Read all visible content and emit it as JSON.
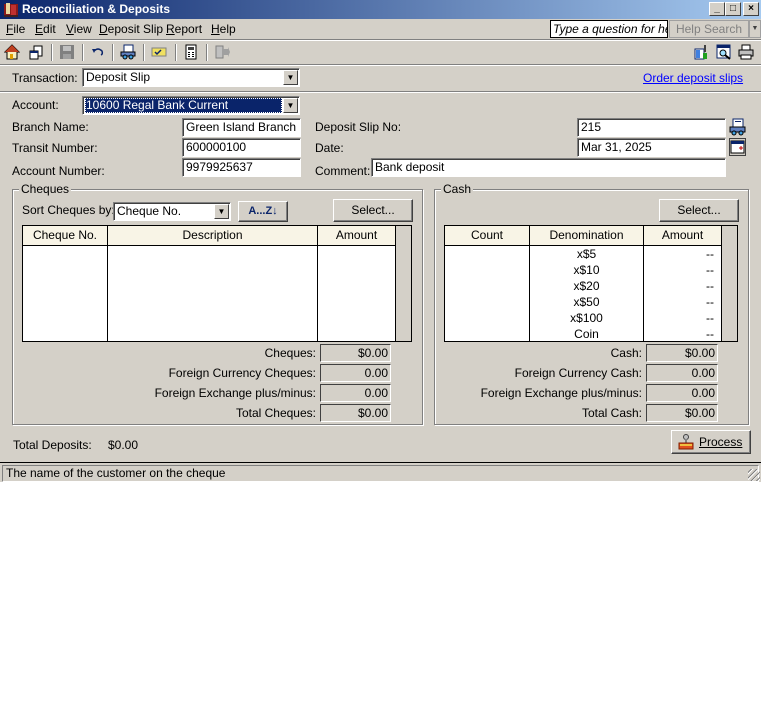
{
  "window": {
    "title": "Reconciliation & Deposits",
    "controls": {
      "minimize": "_",
      "maximize": "□",
      "close": "×"
    }
  },
  "menubar": {
    "items": [
      {
        "label": "File",
        "accel": "F"
      },
      {
        "label": "Edit",
        "accel": "E"
      },
      {
        "label": "View",
        "accel": "V"
      },
      {
        "label": "Deposit Slip",
        "accel": "D"
      },
      {
        "label": "Report",
        "accel": "R"
      },
      {
        "label": "Help",
        "accel": "H"
      }
    ],
    "help_placeholder": "Type a question for help",
    "help_search_label": "Help Search"
  },
  "toolbar": {
    "left_icons": [
      "home-icon",
      "windows-icon",
      "save-icon",
      "undo-icon",
      "print-deposit-icon",
      "cleared-icon",
      "calculator-icon",
      "export-icon"
    ],
    "right_icons": [
      "customize-icon",
      "preview-icon",
      "printer-icon"
    ]
  },
  "form": {
    "transaction_label": "Transaction:",
    "transaction_value": "Deposit Slip",
    "order_link": "Order deposit slips",
    "account_label": "Account:",
    "account_value": "10600 Regal Bank Current",
    "branch_label": "Branch Name:",
    "branch_value": "Green Island Branch",
    "transit_label": "Transit Number:",
    "transit_value": "600000100",
    "account_number_label": "Account Number:",
    "account_number_value": "9979925637",
    "slip_no_label": "Deposit Slip No:",
    "slip_no_value": "215",
    "date_label": "Date:",
    "date_value": "Mar 31, 2025",
    "comment_label": "Comment:",
    "comment_value": "Bank deposit"
  },
  "cheques": {
    "group_title": "Cheques",
    "sort_label": "Sort Cheques by:",
    "sort_value": "Cheque No.",
    "sort_order_label": "A...Z↓",
    "select_label": "Select...",
    "columns": [
      "Cheque No.",
      "Description",
      "Amount"
    ],
    "rows": [],
    "totals": [
      {
        "label": "Cheques:",
        "value": "$0.00"
      },
      {
        "label": "Foreign Currency Cheques:",
        "value": "0.00"
      },
      {
        "label": "Foreign Exchange plus/minus:",
        "value": "0.00"
      },
      {
        "label": "Total Cheques:",
        "value": "$0.00"
      }
    ]
  },
  "cash": {
    "group_title": "Cash",
    "select_label": "Select...",
    "columns": [
      "Count",
      "Denomination",
      "Amount"
    ],
    "rows": [
      {
        "count": "",
        "denomination": "x$5",
        "amount": "--"
      },
      {
        "count": "",
        "denomination": "x$10",
        "amount": "--"
      },
      {
        "count": "",
        "denomination": "x$20",
        "amount": "--"
      },
      {
        "count": "",
        "denomination": "x$50",
        "amount": "--"
      },
      {
        "count": "",
        "denomination": "x$100",
        "amount": "--"
      },
      {
        "count": "",
        "denomination": "Coin",
        "amount": "--"
      }
    ],
    "totals": [
      {
        "label": "Cash:",
        "value": "$0.00"
      },
      {
        "label": "Foreign Currency Cash:",
        "value": "0.00"
      },
      {
        "label": "Foreign Exchange plus/minus:",
        "value": "0.00"
      },
      {
        "label": "Total Cash:",
        "value": "$0.00"
      }
    ]
  },
  "footer": {
    "total_deposits_label": "Total Deposits:",
    "total_deposits_value": "$0.00",
    "process_label": "Process",
    "status_text": "The name of the customer on the cheque"
  }
}
